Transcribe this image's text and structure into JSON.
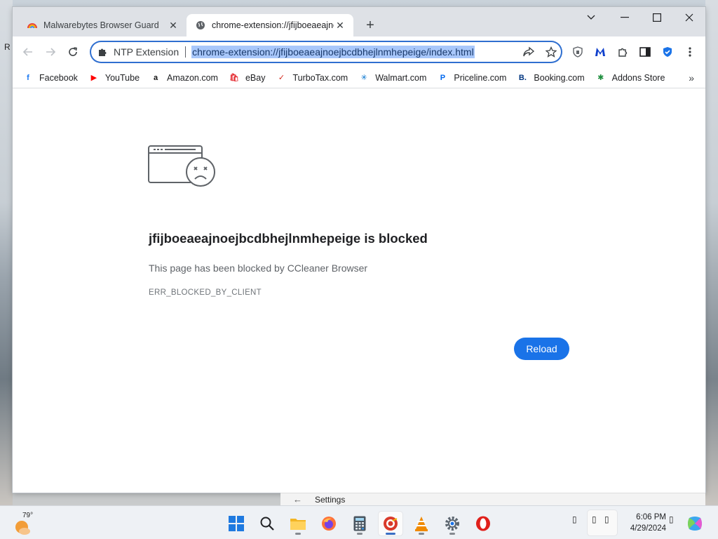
{
  "desktop": {
    "left_glyph": "R"
  },
  "tabs": [
    {
      "title": "Malwarebytes Browser Guard",
      "close": "✕"
    },
    {
      "title": "chrome-extension://jfijboeaeajnoejbcdbhejlnmhepeige/index.html",
      "close": "✕"
    }
  ],
  "window_controls": {
    "new_tab": "+"
  },
  "omnibox": {
    "chip_label": "NTP Extension",
    "url": "chrome-extension://jfijboeaeajnoejbcdbhejlnmhepeige/index.html"
  },
  "bookmarks": [
    {
      "label": "Facebook",
      "icon": "facebook-icon",
      "color": "#1877f2",
      "glyph": "f"
    },
    {
      "label": "YouTube",
      "icon": "youtube-icon",
      "color": "#ff0000",
      "glyph": "▶"
    },
    {
      "label": "Amazon.com",
      "icon": "amazon-icon",
      "color": "#111111",
      "glyph": "a"
    },
    {
      "label": "eBay",
      "icon": "ebay-icon",
      "color": "#e53238",
      "glyph": "🛍"
    },
    {
      "label": "TurboTax.com",
      "icon": "turbotax-icon",
      "color": "#d52b1e",
      "glyph": "✓"
    },
    {
      "label": "Walmart.com",
      "icon": "walmart-icon",
      "color": "#0071ce",
      "glyph": "✳"
    },
    {
      "label": "Priceline.com",
      "icon": "priceline-icon",
      "color": "#0068ef",
      "glyph": "P"
    },
    {
      "label": "Booking.com",
      "icon": "booking-icon",
      "color": "#003580",
      "glyph": "B."
    },
    {
      "label": "Addons Store",
      "icon": "addons-store-icon",
      "color": "#1e8e3e",
      "glyph": "✱"
    }
  ],
  "bookmarks_more": "»",
  "error_page": {
    "title": "jfijboeaeajnoejbcdbhejlnmhepeige is blocked",
    "description": "This page has been blocked by CCleaner Browser",
    "code": "ERR_BLOCKED_BY_CLIENT",
    "reload_label": "Reload",
    "accent": "#1a73e8"
  },
  "settings_strip": {
    "label": "Settings",
    "arrow": "←"
  },
  "taskbar": {
    "temperature": "79°",
    "time": "6:06 PM",
    "date": "4/29/2024",
    "apps": [
      "start-icon",
      "search-icon",
      "file-explorer-icon",
      "firefox-icon",
      "calculator-icon",
      "ccleaner-browser-icon",
      "vlc-icon",
      "settings-icon",
      "opera-icon"
    ]
  }
}
